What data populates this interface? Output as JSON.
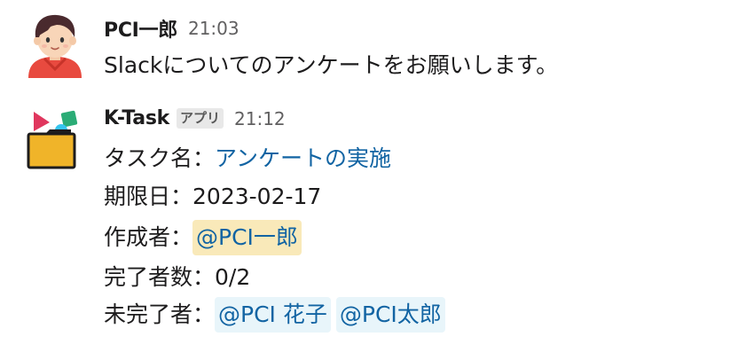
{
  "messages": [
    {
      "sender": "PCI一郎",
      "time": "21:03",
      "avatar_icon": "person-avatar-icon",
      "text": "Slackについてのアンケートをお願いします。"
    },
    {
      "sender": "K-Task",
      "badge": "アプリ",
      "time": "21:12",
      "avatar_icon": "folder-shapes-icon",
      "fields": {
        "task_label": "タスク名：",
        "task_value": "アンケートの実施",
        "due_label": "期限日：",
        "due_value": "2023-02-17",
        "creator_label": "作成者：",
        "creator_mention": "@PCI一郎",
        "done_label": "完了者数：",
        "done_value": "0/2",
        "pending_label": "未完了者：",
        "pending_mentions": [
          "@PCI 花子",
          "@PCI太郎"
        ]
      }
    }
  ],
  "colors": {
    "link": "#1264a3",
    "mention_self_bg": "#f9e9b9",
    "mention_other_bg": "#e8f5fa",
    "folder": "#f0b429"
  }
}
